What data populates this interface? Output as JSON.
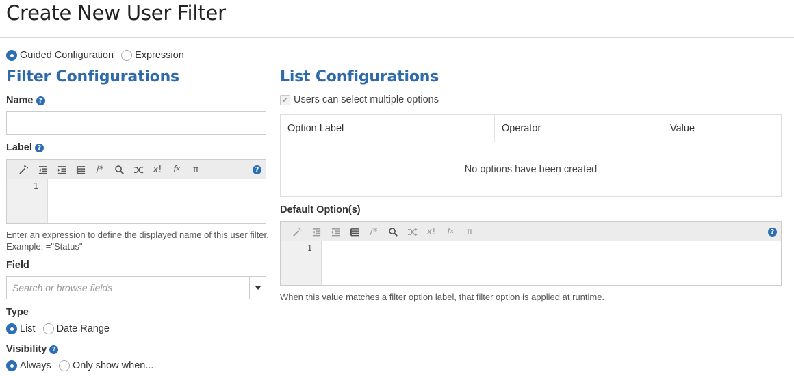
{
  "page": {
    "title": "Create New User Filter"
  },
  "mode": {
    "options": [
      "Guided Configuration",
      "Expression"
    ],
    "selected": "Guided Configuration"
  },
  "filter": {
    "heading": "Filter Configurations",
    "name_label": "Name",
    "name_value": "",
    "label_label": "Label",
    "label_editor": {
      "line_number": "1",
      "value": ""
    },
    "label_hint": "Enter an expression to define the displayed name of this user filter. Example: =\"Status\"",
    "field_label": "Field",
    "field_placeholder": "Search or browse fields",
    "type_label": "Type",
    "type_options": [
      "List",
      "Date Range"
    ],
    "type_selected": "List",
    "visibility_label": "Visibility",
    "visibility_options": [
      "Always",
      "Only show when..."
    ],
    "visibility_selected": "Always"
  },
  "list": {
    "heading": "List Configurations",
    "multi_select_label": "Users can select multiple options",
    "multi_select_checked": true,
    "multi_select_disabled": true,
    "columns": [
      "Option Label",
      "Operator",
      "Value"
    ],
    "empty_message": "No options have been created",
    "default_label": "Default Option(s)",
    "default_editor": {
      "line_number": "1",
      "value": ""
    },
    "default_hint": "When this value matches a filter option label, that filter option is applied at runtime."
  },
  "toolbar_icons": [
    "magic-wand-icon",
    "outdent-icon",
    "indent-icon",
    "list-icon",
    "comment-icon",
    "search-icon",
    "shuffle-icon",
    "factorial-icon",
    "function-icon",
    "pi-icon"
  ],
  "help_glyph": "?",
  "colors": {
    "accent": "#2f6ba8",
    "radio": "#2c6db3"
  }
}
